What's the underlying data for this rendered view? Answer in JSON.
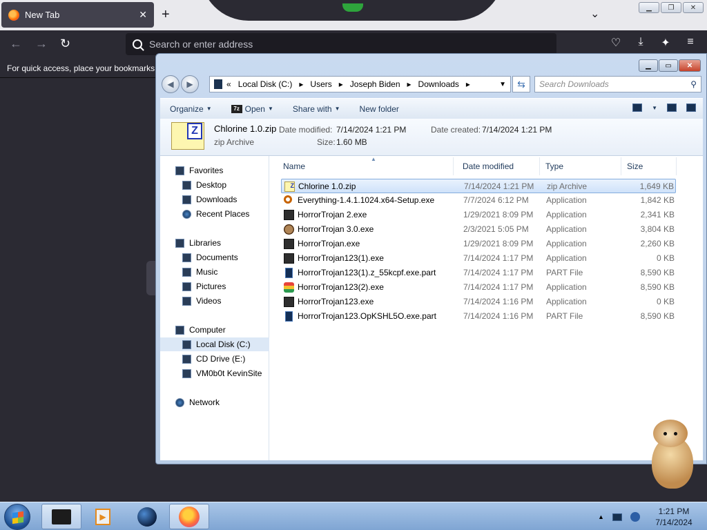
{
  "firefox": {
    "tab_title": "New Tab",
    "tab_close": "✕",
    "new_tab_symbol": "+",
    "url_placeholder": "Search or enter address",
    "bookmarks_hint": "For quick access, place your bookmarks here on the bookmarks toolbar."
  },
  "explorer": {
    "breadcrumb": {
      "prefix": "«",
      "segments": [
        "Local Disk (C:)",
        "Users",
        "Joseph Biden",
        "Downloads"
      ]
    },
    "search_placeholder": "Search Downloads",
    "toolbar": {
      "organize": "Organize",
      "open": "Open",
      "open_icon_text": "7z",
      "share_with": "Share with",
      "new_folder": "New folder"
    },
    "details": {
      "name": "Chlorine 1.0.zip",
      "type": "zip Archive",
      "date_modified_label": "Date modified:",
      "date_modified": "7/14/2024 1:21 PM",
      "date_created_label": "Date created:",
      "date_created": "7/14/2024 1:21 PM",
      "size_label": "Size:",
      "size": "1.60 MB"
    },
    "nav": {
      "favorites": "Favorites",
      "desktop": "Desktop",
      "downloads": "Downloads",
      "recent_places": "Recent Places",
      "libraries": "Libraries",
      "documents": "Documents",
      "music": "Music",
      "pictures": "Pictures",
      "videos": "Videos",
      "computer": "Computer",
      "local_disk": "Local Disk (C:)",
      "cd_drive": "CD Drive (E:)",
      "vm_share": "VM0b0t KevinSite",
      "network": "Network"
    },
    "columns": {
      "name": "Name",
      "date_modified": "Date modified",
      "type": "Type",
      "size": "Size"
    },
    "files": [
      {
        "name": "Chlorine 1.0.zip",
        "date": "7/14/2024 1:21 PM",
        "type": "zip Archive",
        "size": "1,649 KB",
        "icon": "zip-icon"
      },
      {
        "name": "Everything-1.4.1.1024.x64-Setup.exe",
        "date": "7/7/2024 6:12 PM",
        "type": "Application",
        "size": "1,842 KB",
        "icon": "magnifier-icon"
      },
      {
        "name": "HorrorTrojan 2.exe",
        "date": "1/29/2021 8:09 PM",
        "type": "Application",
        "size": "2,341 KB",
        "icon": "app-icon"
      },
      {
        "name": "HorrorTrojan 3.0.exe",
        "date": "2/3/2021 5:05 PM",
        "type": "Application",
        "size": "3,804 KB",
        "icon": "face-icon"
      },
      {
        "name": "HorrorTrojan.exe",
        "date": "1/29/2021 8:09 PM",
        "type": "Application",
        "size": "2,260 KB",
        "icon": "app-icon"
      },
      {
        "name": "HorrorTrojan123(1).exe",
        "date": "7/14/2024 1:17 PM",
        "type": "Application",
        "size": "0 KB",
        "icon": "app-icon"
      },
      {
        "name": "HorrorTrojan123(1).z_55kcpf.exe.part",
        "date": "7/14/2024 1:17 PM",
        "type": "PART File",
        "size": "8,590 KB",
        "icon": "part-file-icon"
      },
      {
        "name": "HorrorTrojan123(2).exe",
        "date": "7/14/2024 1:17 PM",
        "type": "Application",
        "size": "8,590 KB",
        "icon": "colorful-app-icon"
      },
      {
        "name": "HorrorTrojan123.exe",
        "date": "7/14/2024 1:16 PM",
        "type": "Application",
        "size": "0 KB",
        "icon": "app-icon"
      },
      {
        "name": "HorrorTrojan123.OpKSHL5O.exe.part",
        "date": "7/14/2024 1:16 PM",
        "type": "PART File",
        "size": "8,590 KB",
        "icon": "part-file-icon"
      }
    ]
  },
  "taskbar": {
    "time": "1:21 PM",
    "date": "7/14/2024",
    "tray_arrow": "▲"
  }
}
